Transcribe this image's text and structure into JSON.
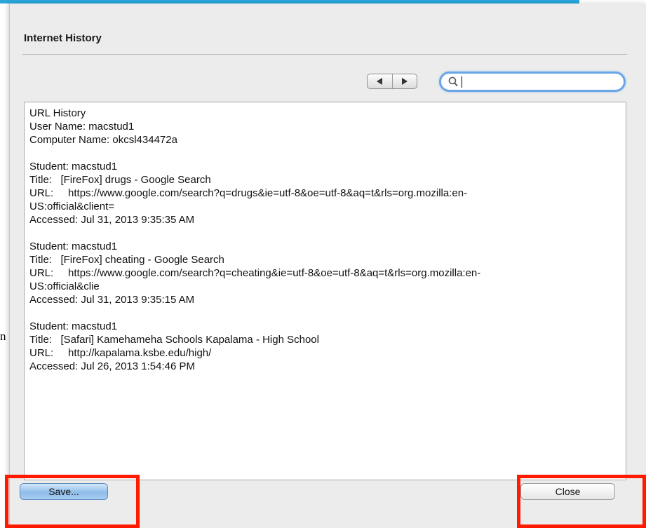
{
  "background": {
    "stray_text": "n"
  },
  "dialog": {
    "title": "Internet History",
    "search": {
      "value": "",
      "placeholder": ""
    },
    "nav": {
      "prev_icon": "triangle-left",
      "next_icon": "triangle-right"
    },
    "history": {
      "header": [
        "URL History",
        "User Name: macstud1",
        "Computer Name: okcsl434472a"
      ],
      "entries": [
        {
          "student": "Student: macstud1",
          "title": "Title:   [FireFox] drugs - Google Search",
          "url_1": "URL:     https://www.google.com/search?q=drugs&ie=utf-8&oe=utf-8&aq=t&rls=org.mozilla:en-",
          "url_2": "US:official&client=",
          "accessed": "Accessed: Jul 31, 2013 9:35:35 AM"
        },
        {
          "student": "Student: macstud1",
          "title": "Title:   [FireFox] cheating - Google Search",
          "url_1": "URL:     https://www.google.com/search?q=cheating&ie=utf-8&oe=utf-8&aq=t&rls=org.mozilla:en-",
          "url_2": "US:official&clie",
          "accessed": "Accessed: Jul 31, 2013 9:35:15 AM"
        },
        {
          "student": "Student: macstud1",
          "title": "Title:   [Safari] Kamehameha Schools Kapalama - High School",
          "url_1": "URL:     http://kapalama.ksbe.edu/high/",
          "accessed": "Accessed: Jul 26, 2013 1:54:46 PM"
        }
      ]
    },
    "buttons": {
      "save": "Save...",
      "close": "Close"
    }
  },
  "colors": {
    "accent": "#2aa6dc",
    "highlight": "#ff1a00",
    "save_button": "#8fbde9"
  }
}
